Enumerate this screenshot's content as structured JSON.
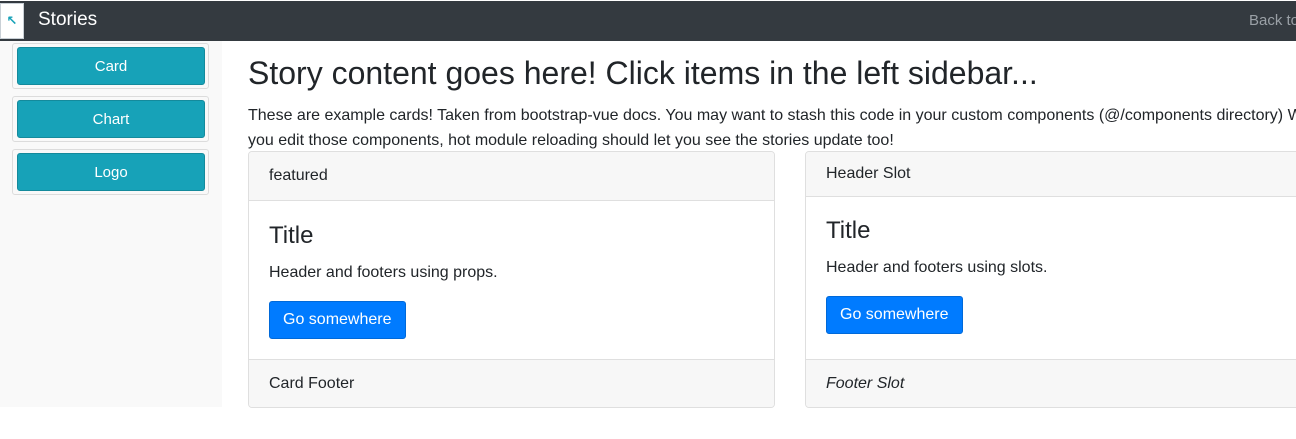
{
  "navbar": {
    "icon": "arrow-up-left-icon",
    "title": "Stories",
    "back_link": "Back to"
  },
  "sidebar": {
    "items": [
      {
        "label": "Card"
      },
      {
        "label": "Chart"
      },
      {
        "label": "Logo"
      }
    ]
  },
  "main": {
    "title": "Story content goes here! Click items in the left sidebar...",
    "description_line1": "These are example cards! Taken from bootstrap-vue docs. You may want to stash this code in your custom components (@/components directory) When",
    "description_line2": "you edit those components, hot module reloading should let you see the stories update too!",
    "cards": [
      {
        "header": "featured",
        "title": "Title",
        "text": "Header and footers using props.",
        "button": "Go somewhere",
        "footer": "Card Footer"
      },
      {
        "header": "Header Slot",
        "title": "Title",
        "text": "Header and footers using slots.",
        "button": "Go somewhere",
        "footer": "Footer Slot"
      }
    ]
  },
  "colors": {
    "navbar_bg": "#343a40",
    "sidebar_button": "#17a2b8",
    "primary_button": "#007bff"
  }
}
